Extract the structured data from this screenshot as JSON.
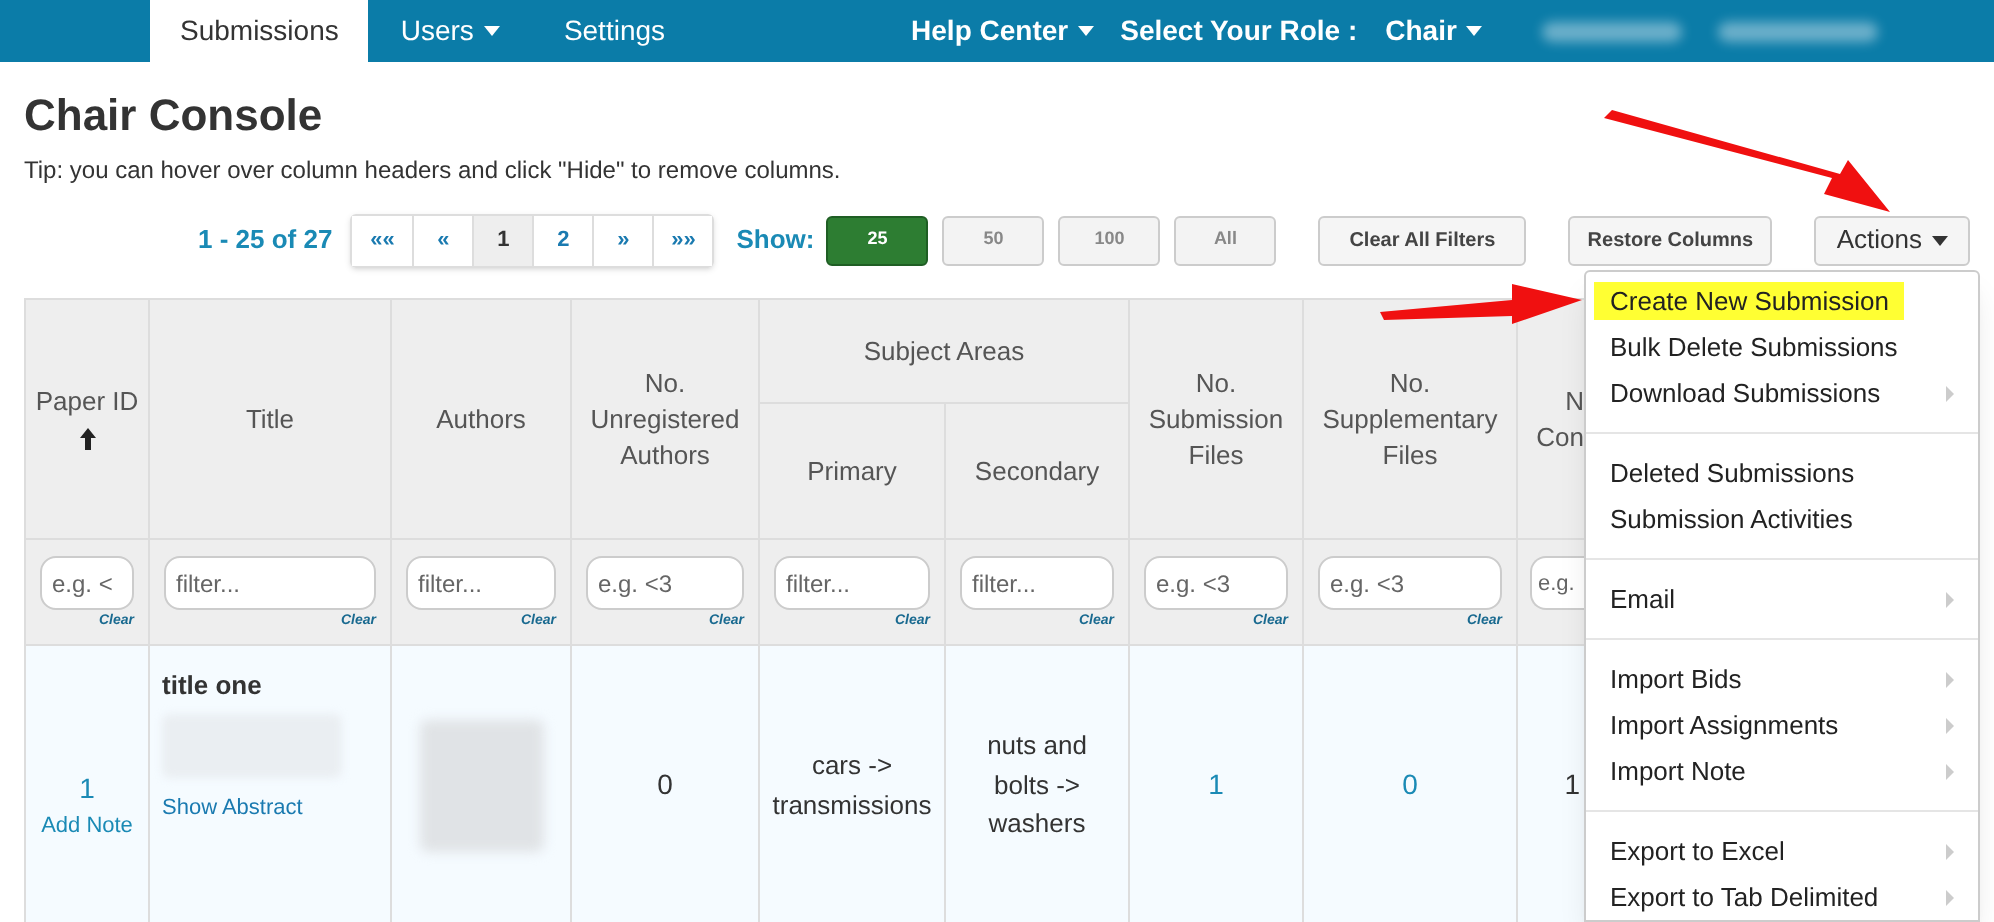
{
  "nav": {
    "tabs": [
      {
        "label": "Submissions",
        "selected": true,
        "dropdown": false
      },
      {
        "label": "Users",
        "selected": false,
        "dropdown": true
      },
      {
        "label": "Settings",
        "selected": false,
        "dropdown": false
      }
    ],
    "help": "Help Center",
    "role_label": "Select Your Role :",
    "role": "Chair"
  },
  "title": "Chair Console",
  "tip": "Tip: you can hover over column headers and click \"Hide\" to remove columns.",
  "range": "1 - 25 of 27",
  "pager": [
    {
      "label": "««",
      "selected": false
    },
    {
      "label": "«",
      "selected": false
    },
    {
      "label": "1",
      "selected": true
    },
    {
      "label": "2",
      "selected": false
    },
    {
      "label": "»",
      "selected": false
    },
    {
      "label": "»»",
      "selected": false
    }
  ],
  "show_label": "Show:",
  "show": [
    {
      "label": "25",
      "selected": true
    },
    {
      "label": "50",
      "selected": false
    },
    {
      "label": "100",
      "selected": false
    },
    {
      "label": "All",
      "selected": false
    }
  ],
  "clear_filters": "Clear All Filters",
  "restore_columns": "Restore Columns",
  "actions": "Actions",
  "table": {
    "columns": [
      {
        "header": "Paper ID",
        "sorted": true,
        "placeholder": "e.g. <",
        "clear": "Clear"
      },
      {
        "header": "Title",
        "sorted": false,
        "placeholder": "filter...",
        "clear": "Clear"
      },
      {
        "header": "Authors",
        "sorted": false,
        "placeholder": "filter...",
        "clear": "Clear"
      },
      {
        "header": "No. Unregistered Authors",
        "sorted": false,
        "placeholder": "e.g. <3",
        "clear": "Clear"
      },
      {
        "header": "Subject Areas",
        "sorted": false,
        "children": [
          {
            "header": "Primary",
            "sorted": false,
            "placeholder": "filter...",
            "clear": "Clear"
          },
          {
            "header": "Secondary",
            "sorted": false,
            "placeholder": "filter...",
            "clear": "Clear"
          }
        ]
      },
      {
        "header": "No. Submission Files",
        "sorted": false,
        "placeholder": "e.g. <3",
        "clear": "Clear"
      },
      {
        "header": "No. Supplementary Files",
        "sorted": false,
        "placeholder": "e.g. <3",
        "clear": "Clear"
      },
      {
        "header": "N Con",
        "sorted": false,
        "placeholder": "e.g."
      }
    ],
    "row": {
      "paper_id": "1",
      "add_note": "Add Note",
      "title": "title one",
      "show_abstract": "Show Abstract",
      "unregistered": "0",
      "primary": "cars -> transmissions",
      "secondary": "nuts and bolts -> washers",
      "submission_files": "1",
      "supplementary_files": "0",
      "column_9": "1"
    }
  },
  "menu": [
    [
      {
        "label": "Create New Submission",
        "highlighted": true,
        "submenu": false
      },
      {
        "label": "Bulk Delete Submissions",
        "highlighted": false,
        "submenu": false
      },
      {
        "label": "Download Submissions",
        "highlighted": false,
        "submenu": true
      }
    ],
    [
      {
        "label": "Deleted Submissions",
        "highlighted": false,
        "submenu": false
      },
      {
        "label": "Submission Activities",
        "highlighted": false,
        "submenu": false
      }
    ],
    [
      {
        "label": "Email",
        "highlighted": false,
        "submenu": true
      }
    ],
    [
      {
        "label": "Import Bids",
        "highlighted": false,
        "submenu": true
      },
      {
        "label": "Import Assignments",
        "highlighted": false,
        "submenu": true
      },
      {
        "label": "Import Note",
        "highlighted": false,
        "submenu": true
      }
    ],
    [
      {
        "label": "Export to Excel",
        "highlighted": false,
        "submenu": true
      },
      {
        "label": "Export to Tab Delimited",
        "highlighted": false,
        "submenu": true
      }
    ]
  ]
}
